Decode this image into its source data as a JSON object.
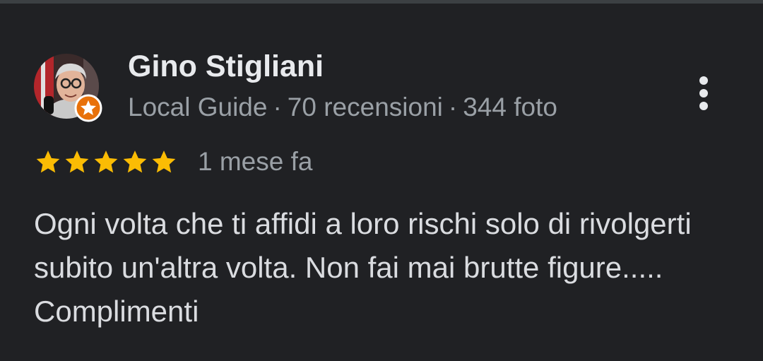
{
  "review": {
    "author": {
      "name": "Gino Stigliani",
      "badge": "Local Guide",
      "separator": "·",
      "reviews_count": "70 recensioni",
      "photos_count": "344 foto",
      "avatar_icon": "user-photo-avatar",
      "local_guide_badge_icon": "star-badge-icon",
      "badge_color": "#e8710a"
    },
    "rating": {
      "stars": 5,
      "max_stars": 5,
      "star_color": "#fbbc04"
    },
    "date": "1 mese fa",
    "text": "Ogni volta che ti affidi a loro rischi solo di rivolgerti subito un'altra volta. Non fai mai brutte figure..... Complimenti",
    "more_options_icon": "more-vert-icon"
  }
}
